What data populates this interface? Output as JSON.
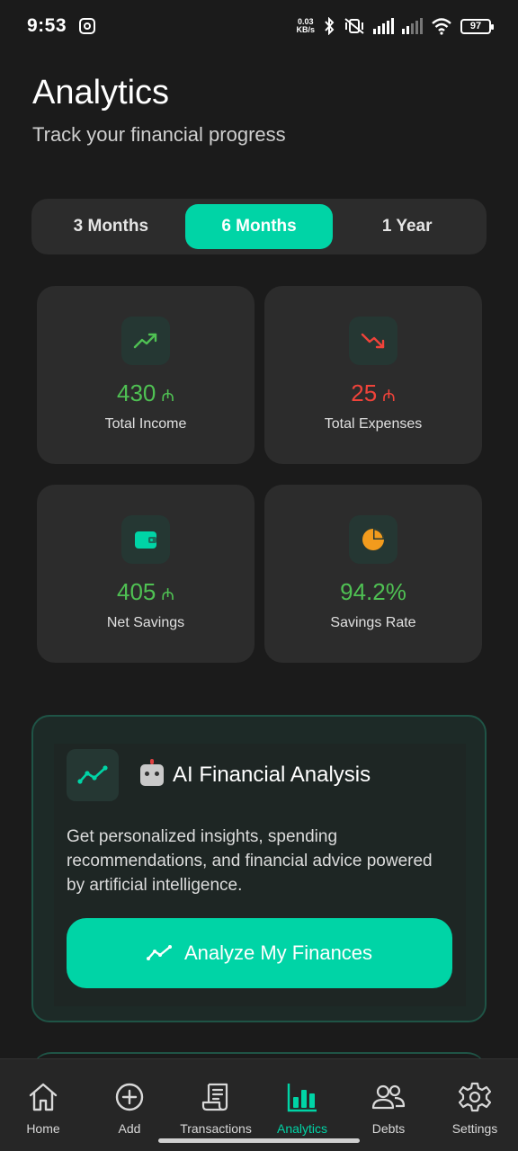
{
  "status_bar": {
    "time": "9:53",
    "net_speed_value": "0.03",
    "net_speed_unit": "KB/s",
    "battery": "97"
  },
  "header": {
    "title": "Analytics",
    "subtitle": "Track your financial progress"
  },
  "period_tabs": [
    {
      "label": "3 Months",
      "active": false
    },
    {
      "label": "6 Months",
      "active": true
    },
    {
      "label": "1 Year",
      "active": false
    }
  ],
  "stats": {
    "income": {
      "value": "430",
      "currency": "₼",
      "label": "Total Income",
      "icon": "trending-up-icon",
      "color": "#4fc153"
    },
    "expenses": {
      "value": "25",
      "currency": "₼",
      "label": "Total Expenses",
      "icon": "trending-down-icon",
      "color": "#f0433a"
    },
    "savings": {
      "value": "405",
      "currency": "₼",
      "label": "Net Savings",
      "icon": "wallet-icon",
      "color": "#4fc153"
    },
    "rate": {
      "value": "94.2%",
      "label": "Savings Rate",
      "icon": "pie-chart-icon",
      "color": "#4fc153"
    }
  },
  "ai_panel": {
    "title": "AI Financial Analysis",
    "description": "Get personalized insights, spending recommendations, and financial advice powered by artificial intelligence.",
    "button_label": "Analyze My Finances",
    "accent": "#00d4a6"
  },
  "bottom_nav": [
    {
      "label": "Home",
      "icon": "home-icon",
      "active": false
    },
    {
      "label": "Add",
      "icon": "add-circle-icon",
      "active": false
    },
    {
      "label": "Transactions",
      "icon": "receipt-icon",
      "active": false
    },
    {
      "label": "Analytics",
      "icon": "bar-chart-icon",
      "active": true
    },
    {
      "label": "Debts",
      "icon": "users-icon",
      "active": false
    },
    {
      "label": "Settings",
      "icon": "gear-icon",
      "active": false
    }
  ]
}
